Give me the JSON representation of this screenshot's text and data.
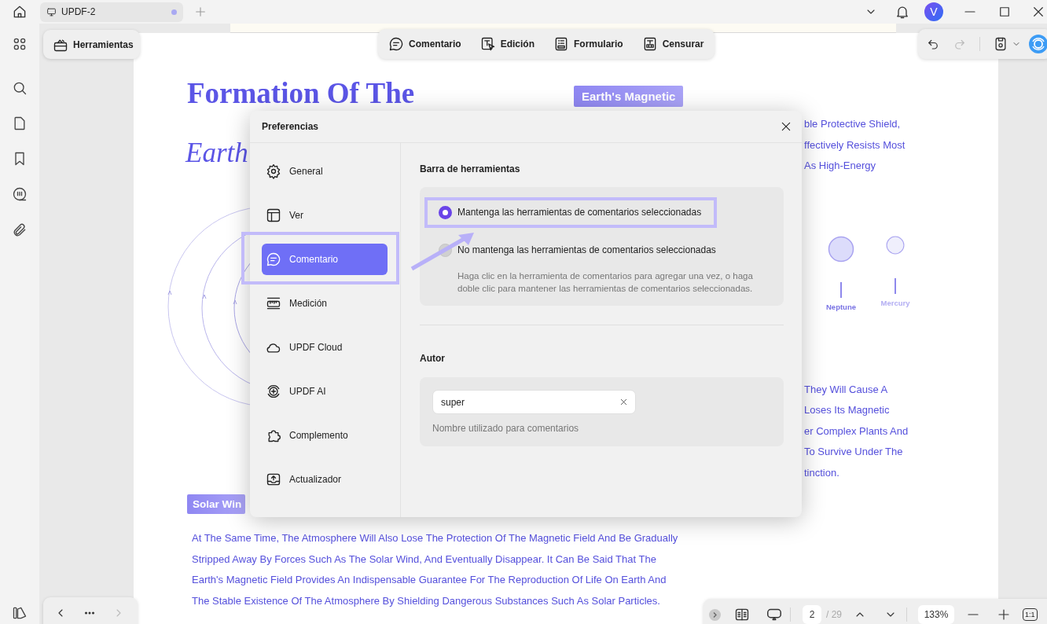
{
  "title_bar": {
    "tab": {
      "label": "UPDF-2",
      "unsaved": true
    },
    "avatar": "V"
  },
  "tools_button": "Herramientas",
  "mode_toolbar": [
    {
      "label": "Comentario",
      "kind": "comment"
    },
    {
      "label": "Edición",
      "kind": "edit"
    },
    {
      "label": "Formulario",
      "kind": "form"
    },
    {
      "label": "Censurar",
      "kind": "redact"
    }
  ],
  "document": {
    "title_lines": [
      "Formation Of The",
      "Earth"
    ],
    "tag_top": "Earth's Magnetic",
    "right_lines_top": [
      "ble Protective Shield,",
      "ffectively Resists Most",
      "As High-Energy"
    ],
    "planets": [
      {
        "name": "Neptune",
        "color": "#dcdcfb"
      },
      {
        "name": "Mercury",
        "color": "#efeffc"
      }
    ],
    "right_lines_bottom": [
      "They Will Cause A",
      "Loses Its Magnetic",
      "er Complex Plants And",
      "To Survive Under The",
      "tinction."
    ],
    "tag_bottom": "Solar Win",
    "paragraph_lines": [
      "At The Same Time, The Atmosphere Will Also Lose The Protection Of The Magnetic Field And Be Gradually",
      "Stripped Away By Forces Such As The Solar Wind, And Eventually Disappear. It Can Be Said That The",
      "Earth's Magnetic Field Provides An Indispensable Guarantee For The Reproduction Of Life On Earth And",
      "The Stable Existence Of The Atmosphere By Shielding Dangerous Substances Such As Solar Particles."
    ]
  },
  "dialog": {
    "title": "Preferencias",
    "nav": [
      {
        "label": "General",
        "kind": "gear",
        "selected": false
      },
      {
        "label": "Ver",
        "kind": "layout",
        "selected": false
      },
      {
        "label": "Comentario",
        "kind": "comment",
        "selected": true
      },
      {
        "label": "Medición",
        "kind": "ruler",
        "selected": false
      },
      {
        "label": "UPDF Cloud",
        "kind": "cloud",
        "selected": false
      },
      {
        "label": "UPDF AI",
        "kind": "ai",
        "selected": false
      },
      {
        "label": "Complemento",
        "kind": "puzzle",
        "selected": false
      },
      {
        "label": "Actualizador",
        "kind": "update",
        "selected": false
      }
    ],
    "toolbar_section": {
      "heading": "Barra de herramientas",
      "options": [
        {
          "label": "Mantenga las herramientas de comentarios seleccionadas",
          "selected": true
        },
        {
          "label": "No mantenga las herramientas de comentarios seleccionadas",
          "selected": false
        }
      ],
      "description": "Haga clic en la herramienta de comentarios para agregar una vez, o haga doble clic para mantener las herramientas de comentarios seleccionadas."
    },
    "author_section": {
      "heading": "Autor",
      "value": "super",
      "hint": "Nombre utilizado para comentarios"
    }
  },
  "page_nav": {
    "page": "2",
    "total": "/ 29",
    "zoom": "133%",
    "fit": "1:1"
  }
}
